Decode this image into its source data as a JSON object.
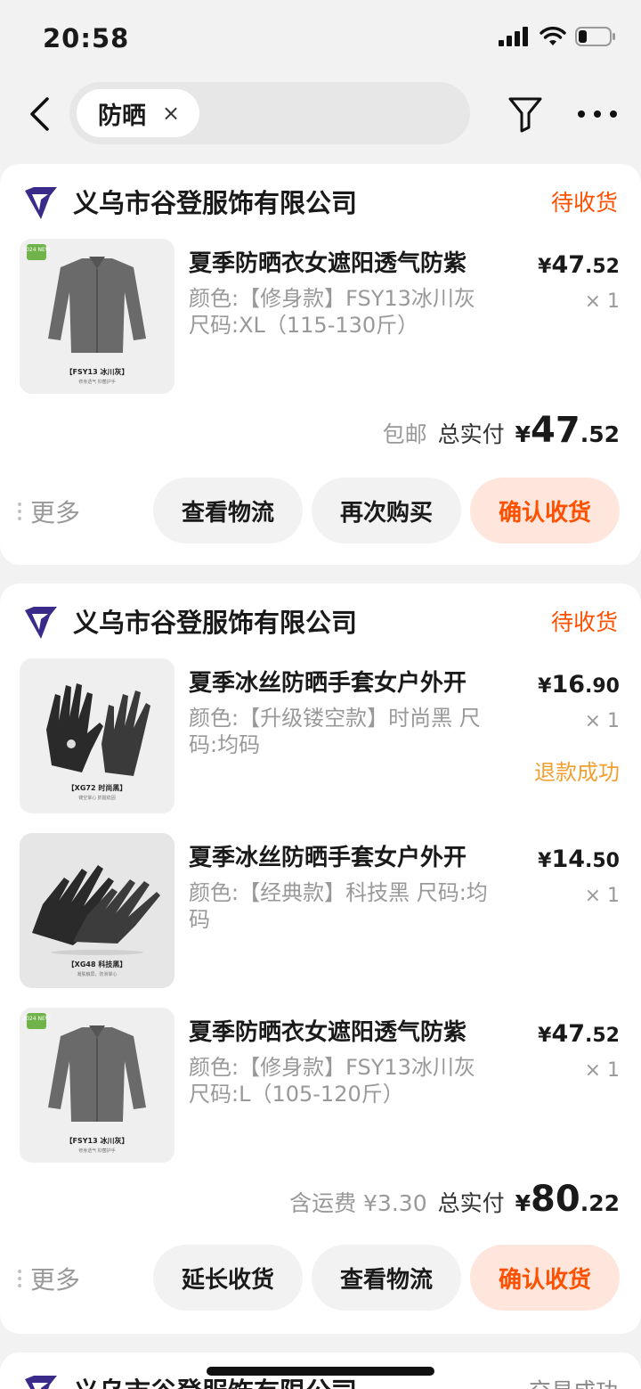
{
  "status_bar": {
    "time": "20:58"
  },
  "search": {
    "tag": "防晒",
    "close": "×"
  },
  "orders": [
    {
      "shop": "义乌市谷登服饰有限公司",
      "status": "待收货",
      "items": [
        {
          "title": "夏季防晒衣女遮阳透气防紫",
          "spec": "颜色:【修身款】FSY13冰川灰 尺码:XL（115-130斤）",
          "price_yen": "¥",
          "price_int": "47",
          "price_dec": ".52",
          "qty": "× 1",
          "thumb": {
            "badge": "2024 NEW",
            "caption": "【FSY13 冰川灰】",
            "sub": "修身透气 抑菌护手"
          }
        }
      ],
      "total": {
        "note": "包邮",
        "label": "总实付",
        "yen": "¥",
        "int": "47",
        "dec": ".52"
      },
      "more": "更多",
      "buttons": [
        "查看物流",
        "再次购买",
        "确认收货"
      ]
    },
    {
      "shop": "义乌市谷登服饰有限公司",
      "status": "待收货",
      "items": [
        {
          "title": "夏季冰丝防晒手套女户外开",
          "spec": "颜色:【升级镂空款】时尚黑 尺码:均码",
          "price_yen": "¥",
          "price_int": "16",
          "price_dec": ".90",
          "qty": "× 1",
          "refund": "退款成功",
          "thumb": {
            "caption": "【XG72 时尚黑】",
            "sub": "镂空掌心 抓握稳固"
          }
        },
        {
          "title": "夏季冰丝防晒手套女户外开",
          "spec": "颜色:【经典款】科技黑 尺码:均码",
          "price_yen": "¥",
          "price_int": "14",
          "price_dec": ".50",
          "qty": "× 1",
          "thumb": {
            "caption": "【XG48 科技黑】",
            "sub": "凝肤触屏，防滑掌心"
          }
        },
        {
          "title": "夏季防晒衣女遮阳透气防紫",
          "spec": "颜色:【修身款】FSY13冰川灰 尺码:L（105-120斤）",
          "price_yen": "¥",
          "price_int": "47",
          "price_dec": ".52",
          "qty": "× 1",
          "thumb": {
            "badge": "2024 NEW",
            "caption": "【FSY13 冰川灰】",
            "sub": "修身透气 抑菌护手"
          }
        }
      ],
      "total": {
        "note": "含运费 ¥3.30",
        "label": "总实付",
        "yen": "¥",
        "int": "80",
        "dec": ".22"
      },
      "more": "更多",
      "buttons": [
        "延长收货",
        "查看物流",
        "确认收货"
      ]
    },
    {
      "shop": "义乌市谷登服饰有限公司",
      "status": "交易成功"
    }
  ],
  "colors": {
    "accent": "#ff5000",
    "refund": "#f0a030",
    "muted": "#999999",
    "brand_logo": "#3a2a8a"
  },
  "icons": [
    "back-arrow-icon",
    "filter-funnel-icon",
    "more-dots-icon",
    "shop-logo-icon",
    "signal-icon",
    "wifi-icon",
    "battery-icon"
  ]
}
